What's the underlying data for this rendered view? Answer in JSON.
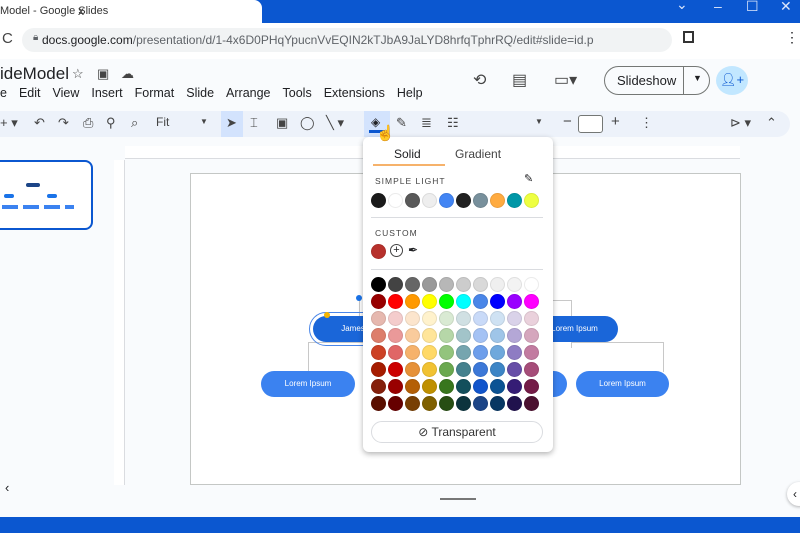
{
  "browser": {
    "tab_title": "Model - Google Slides",
    "close": "x",
    "new_tab": "+",
    "url_host": "docs.google.com",
    "url_path": "/presentation/d/1-4x6D0PHqYpucnVvEQIN2kTJbA9JaLYD8hrfqTphrRQ/edit#slide=id.p"
  },
  "doc": {
    "title": "ideModel"
  },
  "menu": [
    "e",
    "Edit",
    "View",
    "Insert",
    "Format",
    "Slide",
    "Arrange",
    "Tools",
    "Extensions",
    "Help"
  ],
  "header": {
    "slideshow": "Slideshow"
  },
  "toolbar": {
    "zoom": "Fit"
  },
  "slide": {
    "nodes": [
      "James",
      "Lorem Ipsum",
      "Lorem Ipsum",
      "Lorem Ipsum"
    ]
  },
  "popup": {
    "tabs": [
      "Solid",
      "Gradient"
    ],
    "simple_light_label": "SIMPLE LIGHT",
    "simple_light": [
      "#1b1b1b",
      "#ffffff",
      "#595959",
      "#eeeeee",
      "#4285f4",
      "#212121",
      "#78909c",
      "#ffab40",
      "#0097a7",
      "#eeff41"
    ],
    "custom_label": "CUSTOM",
    "custom": [
      "#b7312c"
    ],
    "grid": [
      [
        "#000000",
        "#434343",
        "#666666",
        "#999999",
        "#b7b7b7",
        "#cccccc",
        "#d9d9d9",
        "#efefef",
        "#f3f3f3",
        "#ffffff"
      ],
      [
        "#980000",
        "#ff0000",
        "#ff9900",
        "#ffff00",
        "#00ff00",
        "#00ffff",
        "#4a86e8",
        "#0000ff",
        "#9900ff",
        "#ff00ff"
      ],
      [
        "#e6b8af",
        "#f4cccc",
        "#fce5cd",
        "#fff2cc",
        "#d9ead3",
        "#d0e0e3",
        "#c9daf8",
        "#cfe2f3",
        "#d9d2e9",
        "#ead1dc"
      ],
      [
        "#dd7e6b",
        "#ea9999",
        "#f9cb9c",
        "#ffe599",
        "#b6d7a8",
        "#a2c4c9",
        "#a4c2f4",
        "#9fc5e8",
        "#b4a7d6",
        "#d5a6bd"
      ],
      [
        "#cc4125",
        "#e06666",
        "#f6b26b",
        "#ffd966",
        "#93c47d",
        "#76a5af",
        "#6d9eeb",
        "#6fa8dc",
        "#8e7cc3",
        "#c27ba0"
      ],
      [
        "#a61c00",
        "#cc0000",
        "#e69138",
        "#f1c232",
        "#6aa84f",
        "#45818e",
        "#3c78d8",
        "#3d85c6",
        "#674ea7",
        "#a64d79"
      ],
      [
        "#85200c",
        "#990000",
        "#b45f06",
        "#bf9000",
        "#38761d",
        "#134f5c",
        "#1155cc",
        "#0b5394",
        "#351c75",
        "#741b47"
      ],
      [
        "#5b0f00",
        "#660000",
        "#783f04",
        "#7f6000",
        "#274e13",
        "#0c343d",
        "#1c4587",
        "#073763",
        "#20124d",
        "#4c1130"
      ]
    ],
    "transparent": "Transparent"
  }
}
